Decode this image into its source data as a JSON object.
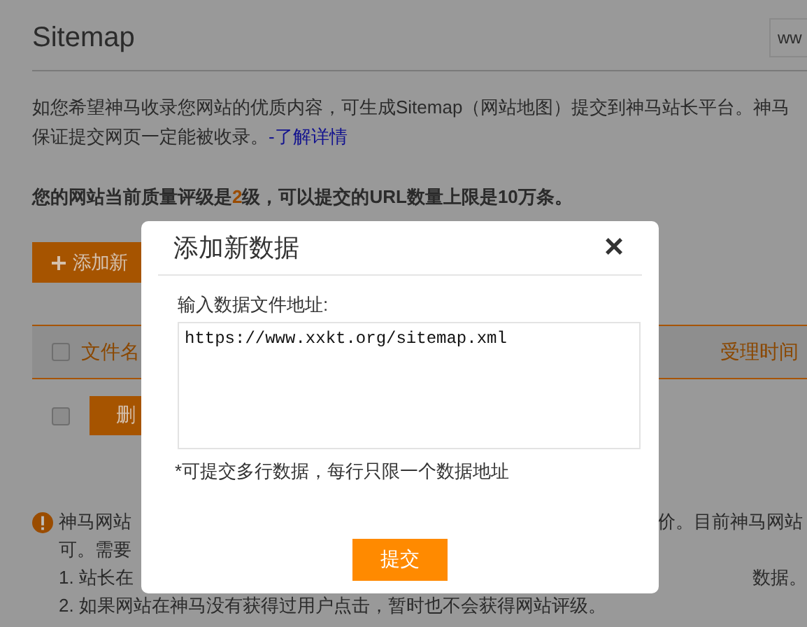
{
  "page": {
    "title": "Sitemap",
    "site_field": {
      "value": "ww"
    },
    "intro": {
      "lines": [
        "如您希望神马收录您网站的优质内容，可生成Sitemap（网站地图）提交到神马站长平台。神马",
        "保证提交网页一定能被收录。"
      ],
      "link": "-了解详情"
    },
    "quota": {
      "prefix": "您的网站当前质量评级是",
      "rating": "2",
      "suffix": "级，可以提交的URL数量上限是10万条。"
    },
    "add_button": {
      "label": "添加新"
    },
    "table": {
      "header_checked": false,
      "columns": [
        {
          "label": "文件名"
        },
        {
          "label": "受理时间"
        }
      ],
      "rows": [
        {
          "checked": false,
          "delete_button": "删"
        }
      ]
    },
    "notice": {
      "lines": [
        {
          "left": "神马网站",
          "right": "价。目前神马网站"
        },
        {
          "left": "可。需要"
        },
        {
          "left": "1. 站长在",
          "right": "数据。"
        },
        {
          "left": "2. 如果网站在神马没有获得过用户点击，暂时也不会获得网站评级。"
        }
      ]
    }
  },
  "dialog": {
    "title": "添加新数据",
    "close": "×",
    "label": "输入数据文件地址:",
    "value": "https://www.xxkt.org/sitemap.xml",
    "hint": "*可提交多行数据，每行只限一个数据地址",
    "submit": "提交"
  }
}
